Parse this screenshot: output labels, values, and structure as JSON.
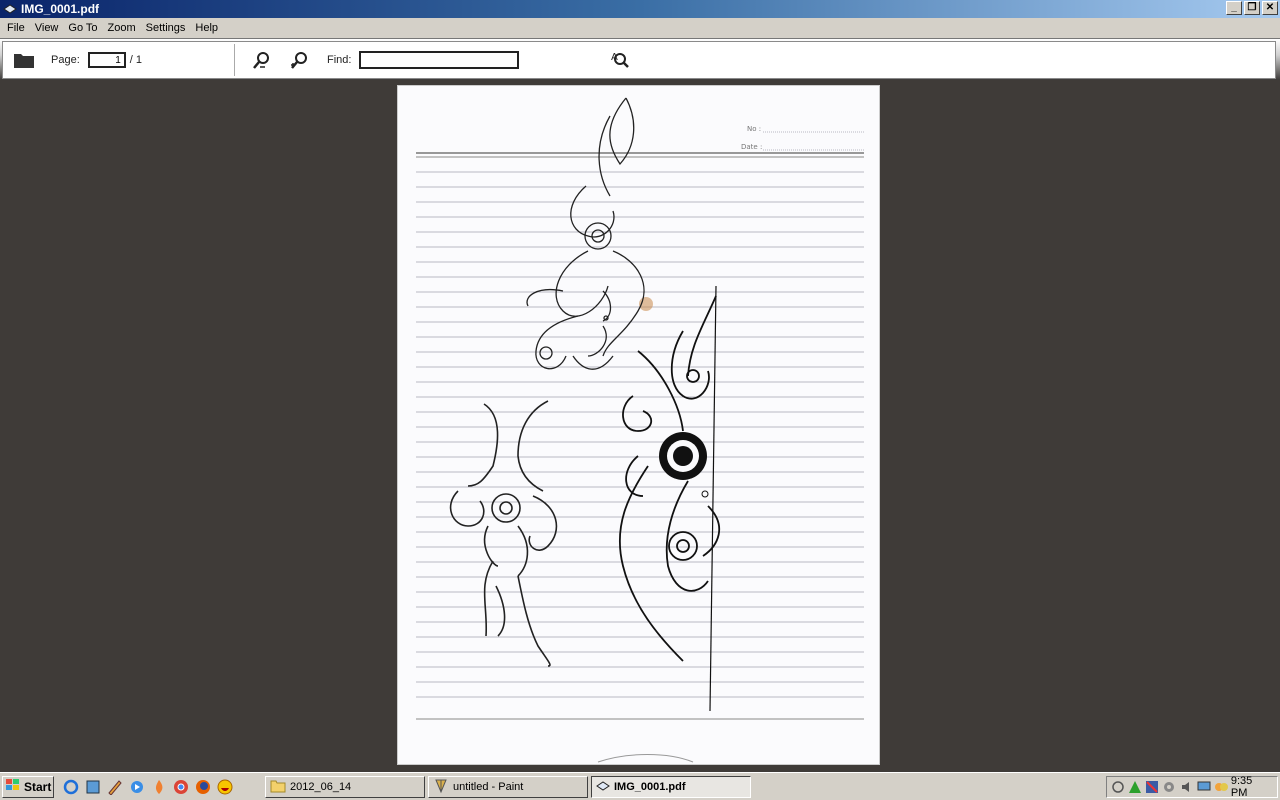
{
  "window": {
    "title": "IMG_0001.pdf",
    "min": "_",
    "restore": "❐",
    "close": "✕"
  },
  "menu": [
    "File",
    "View",
    "Go To",
    "Zoom",
    "Settings",
    "Help"
  ],
  "toolbar": {
    "page_label": "Page:",
    "page_value": "1",
    "page_total": "/ 1",
    "find_label": "Find:",
    "find_value": ""
  },
  "document": {
    "no_label": "No :",
    "date_label": "Date :"
  },
  "taskbar": {
    "start_label": "Start",
    "tasks": [
      {
        "label": "2012_06_14",
        "icon": "folder-icon"
      },
      {
        "label": "untitled - Paint",
        "icon": "paint-icon"
      },
      {
        "label": "IMG_0001.pdf",
        "icon": "pdf-viewer-icon"
      }
    ],
    "clock": "9:35 PM"
  }
}
